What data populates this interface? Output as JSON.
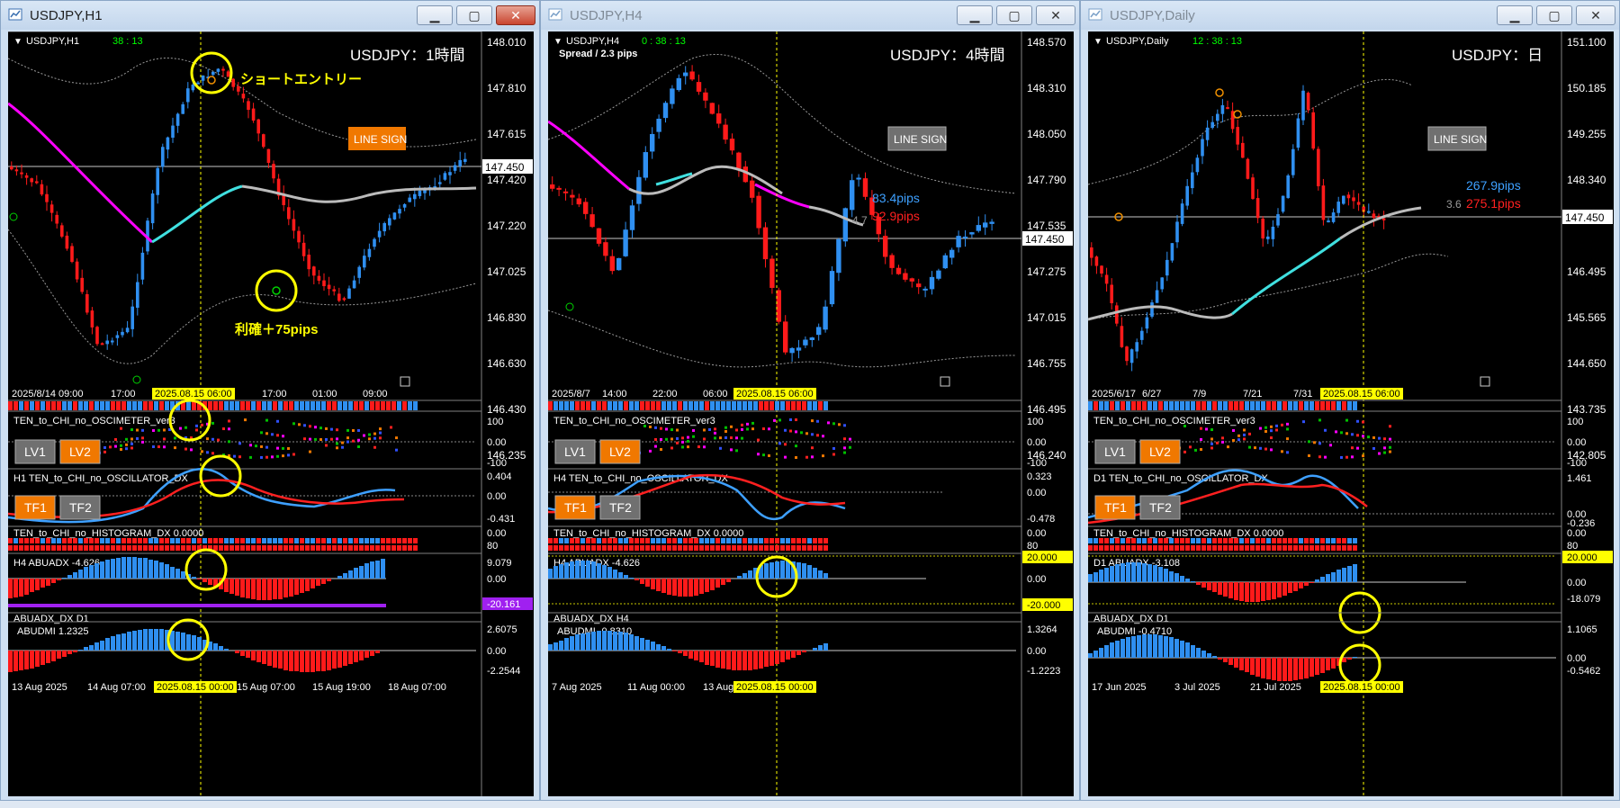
{
  "windows": [
    {
      "title": "USDJPY,H1",
      "active": true,
      "symbol_label": "USDJPY,H1",
      "timer": "38 : 13",
      "spread": "",
      "big_label": "USDJPY：1時間",
      "price_axis": [
        "148.010",
        "147.810",
        "147.615",
        "147.420",
        "147.220",
        "147.025",
        "146.830",
        "146.630",
        "146.430",
        "146.235"
      ],
      "current_price": "147.450",
      "line_sign": "LINE SIGN",
      "annotations": {
        "entry": "ショートエントリー",
        "profit": "利確＋75pips"
      },
      "pips_blue": "",
      "pips_red": "",
      "pips_small": "",
      "time_axis": [
        "2025/8/14 09:00",
        "17:00",
        "17:00",
        "01:00",
        "09:00"
      ],
      "time_highlight": "2025.08.15 06:00",
      "osc1": {
        "label": "TEN_to_CHI_no_OSCIMETER_ver3",
        "axis": [
          "100",
          "0.00",
          "-100"
        ],
        "btn1": "LV1",
        "btn2": "LV2"
      },
      "osc2": {
        "label": "H1 TEN_to_CHI_no_OSCILLATOR_DX",
        "axis": [
          "0.404",
          "0.00",
          "-0.431"
        ],
        "btn1": "TF1",
        "btn2": "TF2"
      },
      "hist": {
        "label": "TEN_to_CHI_no_HISTOGRAM_DX 0.0000",
        "axis": [
          "0.00",
          "80"
        ]
      },
      "abuadx": {
        "label": "H4 ABUADX  -4.626",
        "axis_top": "9.079",
        "axis_mid": "0.00",
        "axis_bot": "-20.161"
      },
      "abuadx_d1": {
        "label": "ABUADX_DX D1"
      },
      "abudmi": {
        "label": "ABUDMI  1.2325",
        "axis": [
          "2.6075",
          "0.00",
          "-2.2544"
        ]
      },
      "bottom_axis": [
        "13 Aug 2025",
        "14 Aug 07:00",
        "15 Aug 07:00",
        "15 Aug 19:00",
        "18 Aug 07:00"
      ],
      "bottom_highlight": "2025.08.15 00:00"
    },
    {
      "title": "USDJPY,H4",
      "active": false,
      "symbol_label": "USDJPY,H4",
      "timer": "0 : 38 : 13",
      "spread": "Spread / 2.3 pips",
      "big_label": "USDJPY：4時間",
      "price_axis": [
        "148.570",
        "148.310",
        "148.050",
        "147.790",
        "147.535",
        "147.275",
        "147.015",
        "146.755",
        "146.495",
        "146.240"
      ],
      "current_price": "147.450",
      "line_sign": "LINE SIGN",
      "annotations": {
        "entry": "",
        "profit": ""
      },
      "pips_blue": "83.4pips",
      "pips_red": "92.9pips",
      "pips_small": "4.7",
      "time_axis": [
        "2025/8/7",
        "14:00",
        "22:00",
        "06:00"
      ],
      "time_highlight": "2025.08.15 06:00",
      "osc1": {
        "label": "TEN_to_CHI_no_OSCIMETER_ver3",
        "axis": [
          "100",
          "0.00",
          "-100"
        ],
        "btn1": "LV1",
        "btn2": "LV2"
      },
      "osc2": {
        "label": "H4 TEN_to_CHI_no_OSCILLATOR_DX",
        "axis": [
          "0.323",
          "0.00",
          "-0.478"
        ],
        "btn1": "TF1",
        "btn2": "TF2"
      },
      "hist": {
        "label": "TEN_to_CHI_no_HISTOGRAM_DX 0.0000",
        "axis": [
          "0.00",
          "80"
        ]
      },
      "abuadx": {
        "label": "H4 ABUADX  -4.626",
        "axis_top": "20.000",
        "axis_mid": "0.00",
        "axis_bot": "-20.000"
      },
      "abuadx_d1": {
        "label": "ABUADX_DX H4"
      },
      "abudmi": {
        "label": "ABUDMI  -0.8310",
        "axis": [
          "1.3264",
          "0.00",
          "-1.2223"
        ]
      },
      "bottom_axis": [
        "7 Aug 2025",
        "11 Aug 00:00",
        "13 Aug"
      ],
      "bottom_highlight": "2025.08.15 00:00"
    },
    {
      "title": "USDJPY,Daily",
      "active": false,
      "symbol_label": "USDJPY,Daily",
      "timer": "12 : 38 : 13",
      "spread": "",
      "big_label": "USDJPY：日",
      "price_axis": [
        "151.100",
        "150.185",
        "149.255",
        "148.340",
        "147.450",
        "146.495",
        "145.565",
        "144.650",
        "143.735",
        "142.805"
      ],
      "current_price": "147.450",
      "line_sign": "LINE SIGN",
      "annotations": {
        "entry": "",
        "profit": ""
      },
      "pips_blue": "267.9pips",
      "pips_red": "275.1pips",
      "pips_small": "3.6",
      "time_axis": [
        "2025/6/17",
        "6/27",
        "7/9",
        "7/21",
        "7/31"
      ],
      "time_highlight": "2025.08.15 06:00",
      "osc1": {
        "label": "TEN_to_CHI_no_OSCIMETER_ver3",
        "axis": [
          "100",
          "0.00",
          "-100"
        ],
        "btn1": "LV1",
        "btn2": "LV2"
      },
      "osc2": {
        "label": "D1 TEN_to_CHI_no_OSCILLATOR_DX",
        "axis": [
          "1.461",
          "0.00",
          "-0.236"
        ],
        "btn1": "TF1",
        "btn2": "TF2"
      },
      "hist": {
        "label": "TEN_to_CHI_no_HISTOGRAM_DX 0.0000",
        "axis": [
          "0.00",
          "80"
        ]
      },
      "abuadx": {
        "label": "D1 ABUADX  -3.108",
        "axis_top": "20.000",
        "axis_mid": "0.00",
        "axis_bot": "-18.079"
      },
      "abuadx_d1": {
        "label": "ABUADX_DX D1"
      },
      "abudmi": {
        "label": "ABUDMI  -0.4710",
        "axis": [
          "1.1065",
          "0.00",
          "-0.5462"
        ]
      },
      "bottom_axis": [
        "17 Jun 2025",
        "3 Jul 2025",
        "21 Jul 2025"
      ],
      "bottom_highlight": "2025.08.15 00:00"
    }
  ],
  "colors": {
    "bull": "#2f8ff0",
    "bear": "#ff1a1a",
    "magenta": "#ff00ff",
    "cyan": "#40e0e0",
    "yellow": "#ffff00",
    "orange": "#f07800",
    "grey_btn": "#808080",
    "green": "#00d000"
  }
}
